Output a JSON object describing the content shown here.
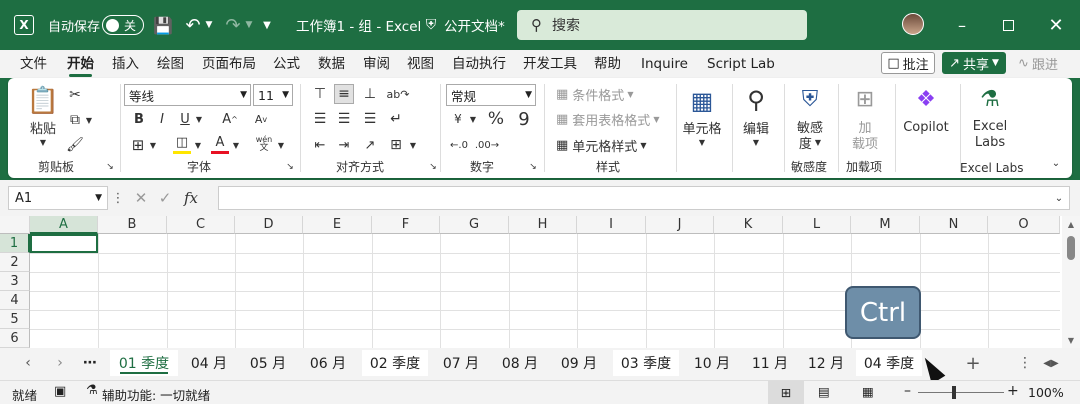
{
  "title": {
    "autosave": "自动保存",
    "toggle": "关",
    "filename": "工作簿1 - 组 - Excel",
    "doc_status": "公开文档*",
    "search": "搜索"
  },
  "menu": [
    "文件",
    "开始",
    "插入",
    "绘图",
    "页面布局",
    "公式",
    "数据",
    "审阅",
    "视图",
    "自动执行",
    "开发工具",
    "帮助",
    "Inquire",
    "Script Lab"
  ],
  "actions": {
    "note": "批注",
    "share": "共享",
    "follow": "跟进"
  },
  "ribbon": {
    "clipboard": {
      "paste": "粘贴",
      "label": "剪贴板"
    },
    "font": {
      "name": "等线",
      "size": "11",
      "bold": "B",
      "italic": "I",
      "underline": "U",
      "grow": "A",
      "shrink": "A",
      "color": "A",
      "wen": "wén",
      "wen2": "文",
      "label": "字体"
    },
    "align": {
      "label": "对齐方式"
    },
    "number": {
      "format": "常规",
      "percent": "%",
      "comma": "9",
      "label": "数字"
    },
    "styles": {
      "cond": "条件格式",
      "table": "套用表格格式",
      "cell": "单元格样式",
      "label": "样式"
    },
    "cells": {
      "label": "单元格"
    },
    "edit": {
      "label": "编辑"
    },
    "sens": {
      "l1": "敏感",
      "l2": "度",
      "label": "敏感度"
    },
    "addin": {
      "l1": "加",
      "l2": "载项",
      "label": "加载项"
    },
    "copilot": {
      "label": "Copilot"
    },
    "labs": {
      "l1": "Excel",
      "l2": "Labs",
      "label": "Excel Labs"
    }
  },
  "formula": {
    "cell": "A1",
    "fx": "fx"
  },
  "columns": [
    "A",
    "B",
    "C",
    "D",
    "E",
    "F",
    "G",
    "H",
    "I",
    "J",
    "K",
    "L",
    "M",
    "N",
    "O"
  ],
  "rows": [
    "1",
    "2",
    "3",
    "4",
    "5",
    "6"
  ],
  "ctrl_key": "Ctrl",
  "tabs": [
    "01 季度",
    "04 月",
    "05 月",
    "06 月",
    "02 季度",
    "07 月",
    "08 月",
    "09 月",
    "03 季度",
    "10 月",
    "11 月",
    "12 月",
    "04 季度"
  ],
  "status": {
    "ready": "就绪",
    "access": "辅助功能: 一切就绪",
    "zoom": "100%"
  }
}
